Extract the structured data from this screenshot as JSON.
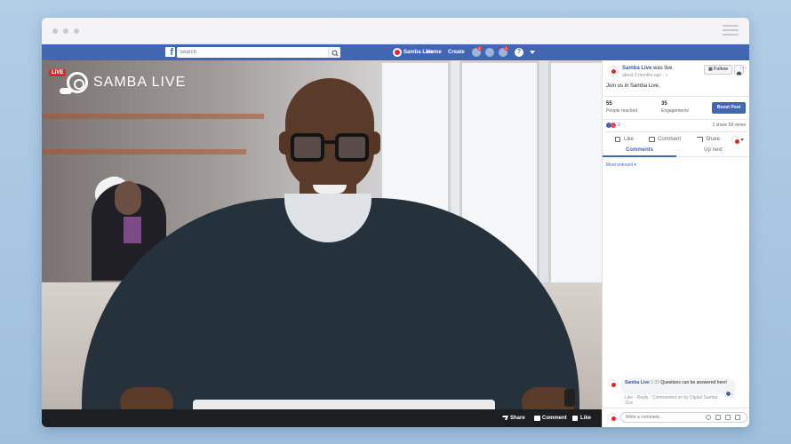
{
  "facebook": {
    "search_placeholder": "Search",
    "page_name": "Samba Live",
    "home": "Home",
    "create": "Create",
    "badge_friends": "1",
    "badge_notifications": "1",
    "help": "?"
  },
  "video": {
    "live_badge": "LIVE",
    "brand": "SAMBA LIVE",
    "actions": {
      "share": "Share",
      "comment": "Comment",
      "like": "Like"
    }
  },
  "post": {
    "author": "Samba Live",
    "status_suffix": "was live.",
    "time": "about 3 months ago ·",
    "follow": "Follow",
    "text": "Join us in Samba Live.",
    "people_reached_value": "55",
    "people_reached_label": "People reached",
    "engagements_value": "35",
    "engagements_label": "Engagements",
    "boost": "Boost Post",
    "reactions_count": "2",
    "share_views": "1 share  58 views",
    "actions": {
      "like": "Like",
      "comment": "Comment",
      "share": "Share"
    },
    "tabs": {
      "comments": "Comments",
      "up_next": "Up next"
    },
    "sort": "Most relevant ▾"
  },
  "comment": {
    "author": "Samba Live",
    "timestamp": "1:33",
    "text": "Questions can be answered here!",
    "meta": "Like · Reply · Commented on by Digital Samba",
    "age": "11w",
    "reaction_count": "1"
  },
  "composer": {
    "placeholder": "Write a comment..."
  },
  "colors": {
    "facebook_blue": "#4267b2",
    "samba_red": "#e3262b",
    "background": "#a9c6e2"
  }
}
